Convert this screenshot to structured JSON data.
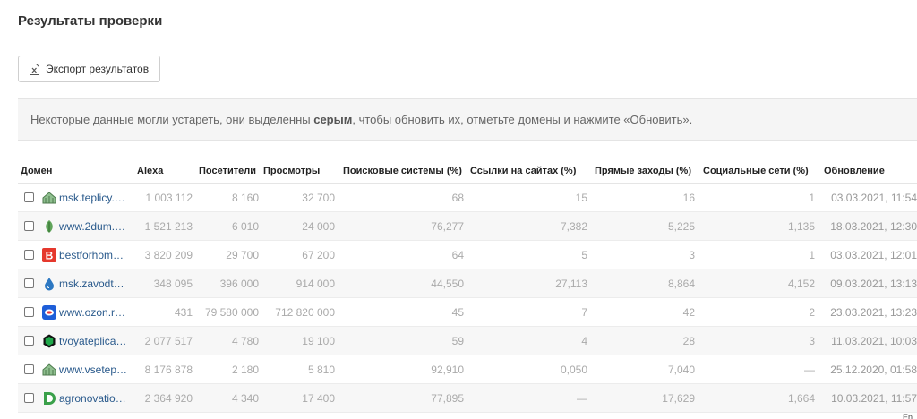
{
  "page": {
    "title": "Результаты проверки",
    "export_label": "Экспорт результатов",
    "notice_part1": "Некоторые данные могли устареть, они выделенны ",
    "notice_bold": "серым",
    "notice_part2": ", чтобы обновить их, отметьте домены и нажмите «Обновить».",
    "lang_badge": "En"
  },
  "table": {
    "headers": {
      "domain": "Домен",
      "alexa": "Alexa",
      "visitors": "Посетители",
      "views": "Просмотры",
      "search": "Поисковые системы (%)",
      "links": "Ссылки на сайтах (%)",
      "direct": "Прямые заходы (%)",
      "social": "Социальные сети (%)",
      "updated": "Обновление"
    },
    "rows": [
      {
        "domain": "msk.teplicy.…",
        "icon": "greenhouse-icon",
        "alexa": "1 003 112",
        "visitors": "8 160",
        "views": "32 700",
        "search": "68",
        "links": "15",
        "direct": "16",
        "social": "1",
        "updated": "03.03.2021, 11:54"
      },
      {
        "domain": "www.2dum.…",
        "icon": "leaf-icon",
        "alexa": "1 521 213",
        "visitors": "6 010",
        "views": "24 000",
        "search": "76,277",
        "links": "7,382",
        "direct": "5,225",
        "social": "1,135",
        "updated": "18.03.2021, 12:30"
      },
      {
        "domain": "bestforhom…",
        "icon": "letter-b-icon",
        "alexa": "3 820 209",
        "visitors": "29 700",
        "views": "67 200",
        "search": "64",
        "links": "5",
        "direct": "3",
        "social": "1",
        "updated": "03.03.2021, 12:01"
      },
      {
        "domain": "msk.zavodt…",
        "icon": "drop-icon",
        "alexa": "348 095",
        "visitors": "396 000",
        "views": "914 000",
        "search": "44,550",
        "links": "27,113",
        "direct": "8,864",
        "social": "4,152",
        "updated": "09.03.2021, 13:13"
      },
      {
        "domain": "www.ozon.r…",
        "icon": "ozon-icon",
        "alexa": "431",
        "visitors": "79 580 000",
        "views": "712 820 000",
        "search": "45",
        "links": "7",
        "direct": "42",
        "social": "2",
        "updated": "23.03.2021, 13:23"
      },
      {
        "domain": "tvoyateplica…",
        "icon": "hexagon-icon",
        "alexa": "2 077 517",
        "visitors": "4 780",
        "views": "19 100",
        "search": "59",
        "links": "4",
        "direct": "28",
        "social": "3",
        "updated": "11.03.2021, 10:03"
      },
      {
        "domain": "www.vsetep…",
        "icon": "greenhouse-icon",
        "alexa": "8 176 878",
        "visitors": "2 180",
        "views": "5 810",
        "search": "92,910",
        "links": "0,050",
        "direct": "7,040",
        "social": "—",
        "updated": "25.12.2020, 01:58"
      },
      {
        "domain": "agronovatio…",
        "icon": "d-letter-icon",
        "alexa": "2 364 920",
        "visitors": "4 340",
        "views": "17 400",
        "search": "77,895",
        "links": "—",
        "direct": "17,629",
        "social": "1,664",
        "updated": "10.03.2021, 11:57"
      }
    ]
  },
  "colors": {
    "link": "#2a5a8c",
    "muted_text": "#aaaaaa",
    "notice_bg": "#f5f5f5"
  }
}
